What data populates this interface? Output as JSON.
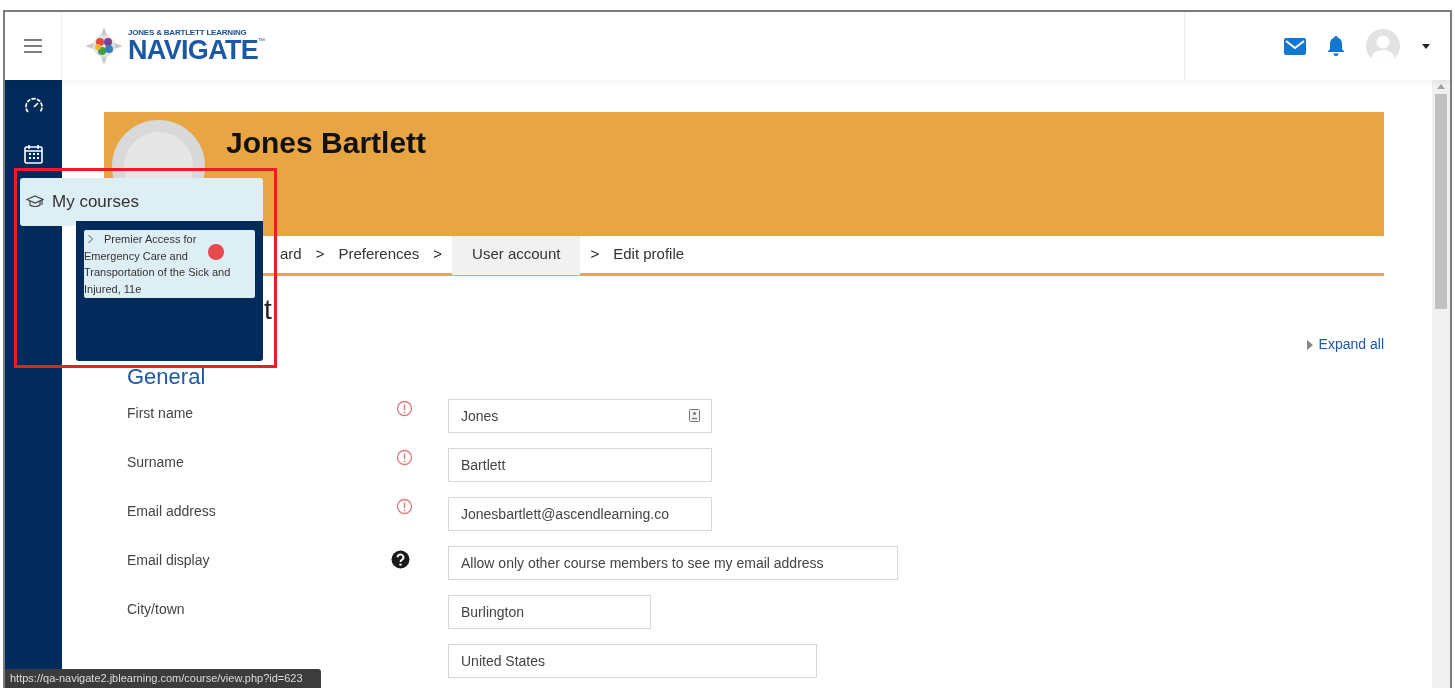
{
  "header": {
    "logo_small": "JONES & BARTLETT LEARNING",
    "logo_text": "NAVIGATE",
    "logo_mark": "™"
  },
  "profile": {
    "name": "Jones Bartlett"
  },
  "breadcrumb": [
    {
      "label": "ard",
      "selected": false
    },
    {
      "label": "Preferences",
      "selected": false
    },
    {
      "label": "User account",
      "selected": true
    },
    {
      "label": "Edit profile",
      "selected": false
    }
  ],
  "breadcrumb_separator": ">",
  "heading_fragment": "t",
  "expand_all": "Expand all",
  "section": "General",
  "fields": [
    {
      "label": "First name",
      "value": "Jones",
      "kind": "required",
      "autofill": true
    },
    {
      "label": "Surname",
      "value": "Bartlett",
      "kind": "required",
      "autofill": false
    },
    {
      "label": "Email address",
      "value": "Jonesbartlett@ascendlearning.co",
      "kind": "required",
      "autofill": false
    },
    {
      "label": "Email display",
      "value": "Allow only other course members to see my email address",
      "kind": "help",
      "autofill": false
    },
    {
      "label": "City/town",
      "value": "Burlington",
      "kind": "plain",
      "autofill": false
    },
    {
      "value": "United States",
      "kind": "plain",
      "autofill": false
    }
  ],
  "popup": {
    "title": "My courses",
    "courses": [
      {
        "title": "Premier Access for Emergency Care and Transportation of the Sick and Injured, 11e"
      }
    ]
  },
  "status_url": "https://qa-navigate2.jblearning.com/course/view.php?id=623"
}
